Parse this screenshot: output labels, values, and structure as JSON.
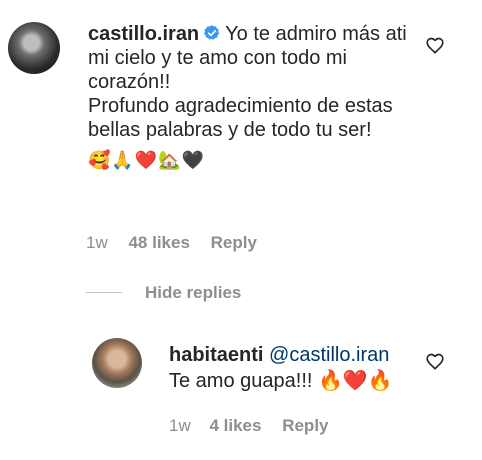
{
  "comments": [
    {
      "username": "castillo.iran",
      "verified": true,
      "text": "Yo te admiro más ati mi cielo y te amo con todo mi corazón!!\nProfundo agradecimiento de estas bellas palabras y de todo tu ser!",
      "emojis": "🥰🙏❤️🏡🖤",
      "time": "1w",
      "likes": "48 likes",
      "reply": "Reply",
      "heart_icon": "heart-outline-icon"
    }
  ],
  "hide_replies_label": "Hide replies",
  "replies": [
    {
      "username": "habitaenti",
      "mention": "@castillo.iran",
      "text": "Te amo guapa!!! 🔥❤️🔥",
      "time": "1w",
      "likes": "4 likes",
      "reply": "Reply",
      "heart_icon": "heart-outline-icon"
    }
  ],
  "colors": {
    "text": "#262626",
    "secondary": "#8e8e8e",
    "mention": "#00376b",
    "verified_blue": "#3897f0"
  }
}
